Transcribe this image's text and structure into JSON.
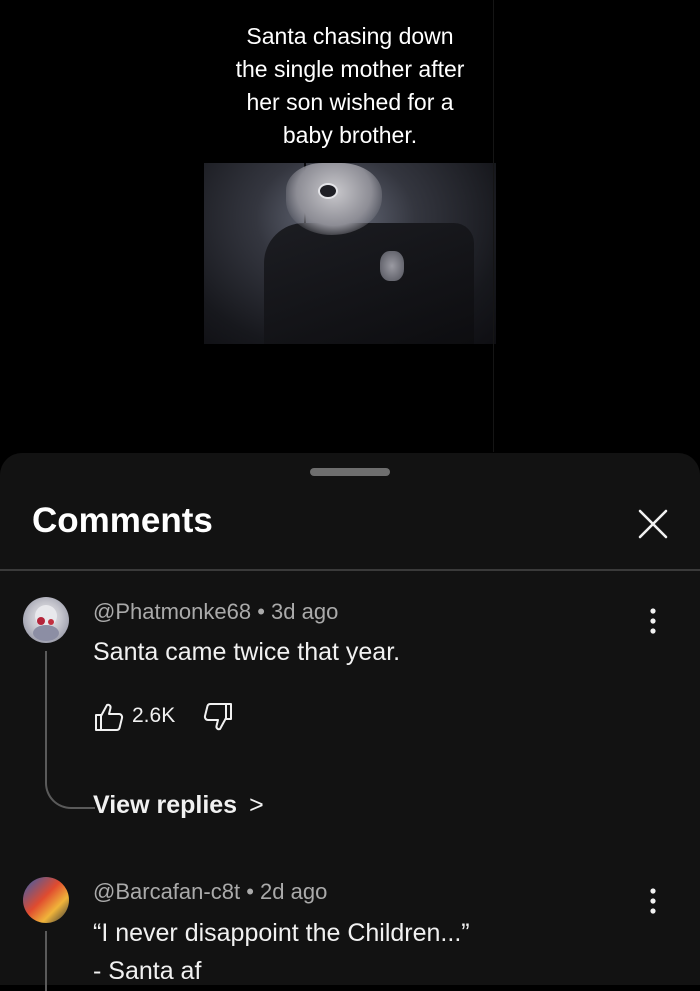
{
  "video": {
    "caption": "Santa chasing down\nthe single mother after\nher son wished for a\nbaby brother."
  },
  "comments_panel": {
    "title": "Comments",
    "comments": [
      {
        "handle": "@Phatmonke68",
        "age": "3d ago",
        "text": "Santa came twice that year.",
        "likes": "2.6K",
        "view_replies_label": "View replies",
        "chevron": ">"
      },
      {
        "handle": "@Barcafan-c8t",
        "age": "2d ago",
        "text_line1": "“I never disappoint the Children...”",
        "text_line2": "- Santa af"
      }
    ]
  },
  "icons": [
    "close-icon",
    "more-options-icon",
    "thumbs-up-icon",
    "thumbs-down-icon",
    "chevron-right-icon"
  ],
  "colors": {
    "background": "#000000",
    "sheet": "#121212",
    "secondary_text": "#aaaaaa"
  }
}
